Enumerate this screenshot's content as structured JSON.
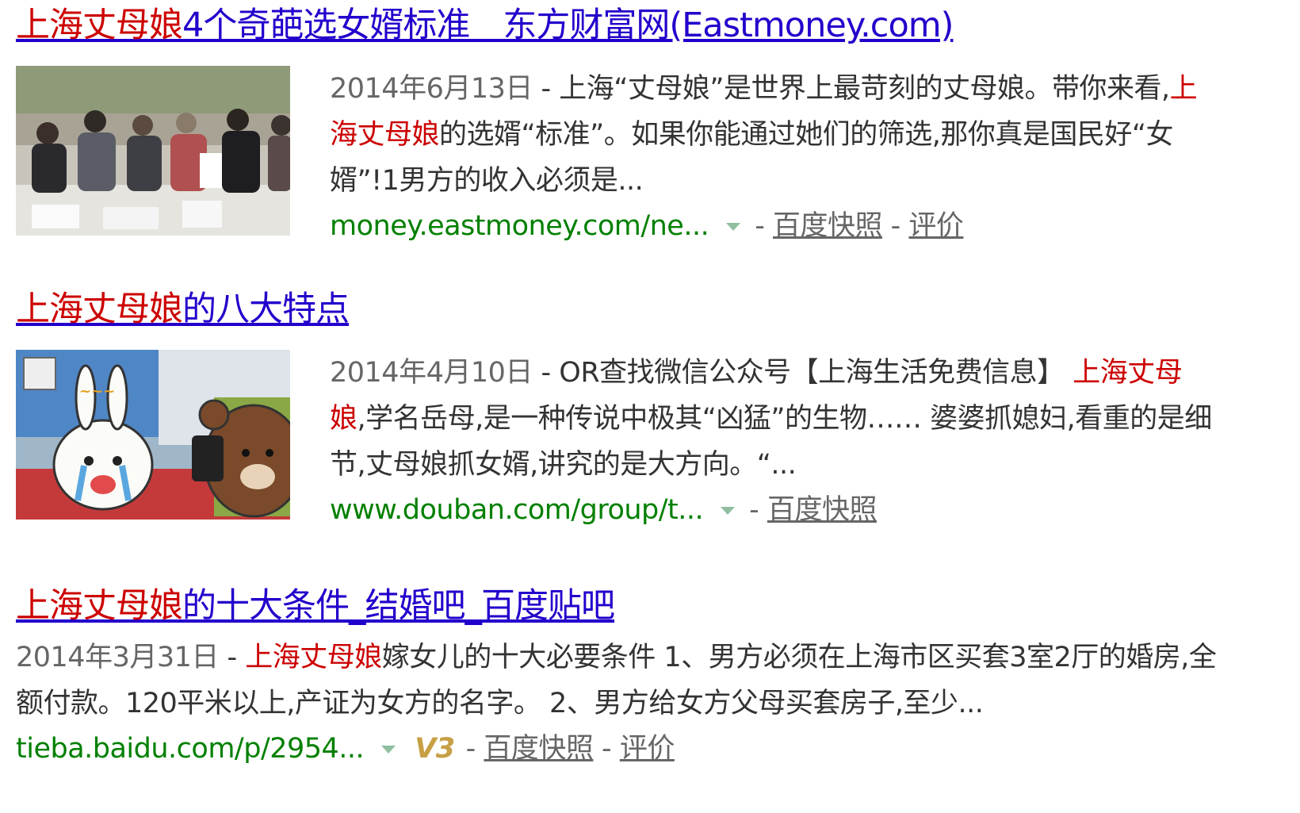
{
  "results": [
    {
      "title_hl": "上海丈母娘",
      "title_rest": "4个奇葩选女婿标准＿东方财富网(Eastmoney.com)",
      "date": "2014年6月13日",
      "snippet_a": " - 上海“丈母娘”是世界上最苛刻的丈母娘。带你来看,",
      "snippet_hl": "上海丈母娘",
      "snippet_b": "的选婿“标准”。如果你能通过她们的筛选,那你真是国民好“女婿”!1男方的收入必须是...",
      "url": "money.eastmoney.com/ne...",
      "cache": "百度快照",
      "rate": "评价"
    },
    {
      "title_hl": "上海丈母娘",
      "title_rest": "的八大特点",
      "date": "2014年4月10日",
      "snippet_a": " - OR查找微信公众号【上海生活免费信息】 ",
      "snippet_hl": "上海丈母娘",
      "snippet_b": ",学名岳母,是一种传说中极其“凶猛”的生物…… 婆婆抓媳妇,看重的是细节,丈母娘抓女婿,讲究的是大方向。“...",
      "url": "www.douban.com/group/t...",
      "cache": "百度快照"
    },
    {
      "title_hl": "上海丈母娘",
      "title_rest": "的十大条件_结婚吧_百度贴吧",
      "date": "2014年3月31日",
      "snippet_a": " - ",
      "snippet_hl": "上海丈母娘",
      "snippet_b": "嫁女儿的十大必要条件 1、男方必须在上海市区买套3室2厅的婚房,全额付款。120平米以上,产证为女方的名字。 2、男方给女方父母买套房子,至少...",
      "url": "tieba.baidu.com/p/2954...",
      "badge": "V3",
      "cache": "百度快照",
      "rate": "评价"
    }
  ],
  "colors": {
    "title_link": "#2200cc",
    "highlight": "#cc0000",
    "url": "#008000",
    "meta": "#666666"
  }
}
